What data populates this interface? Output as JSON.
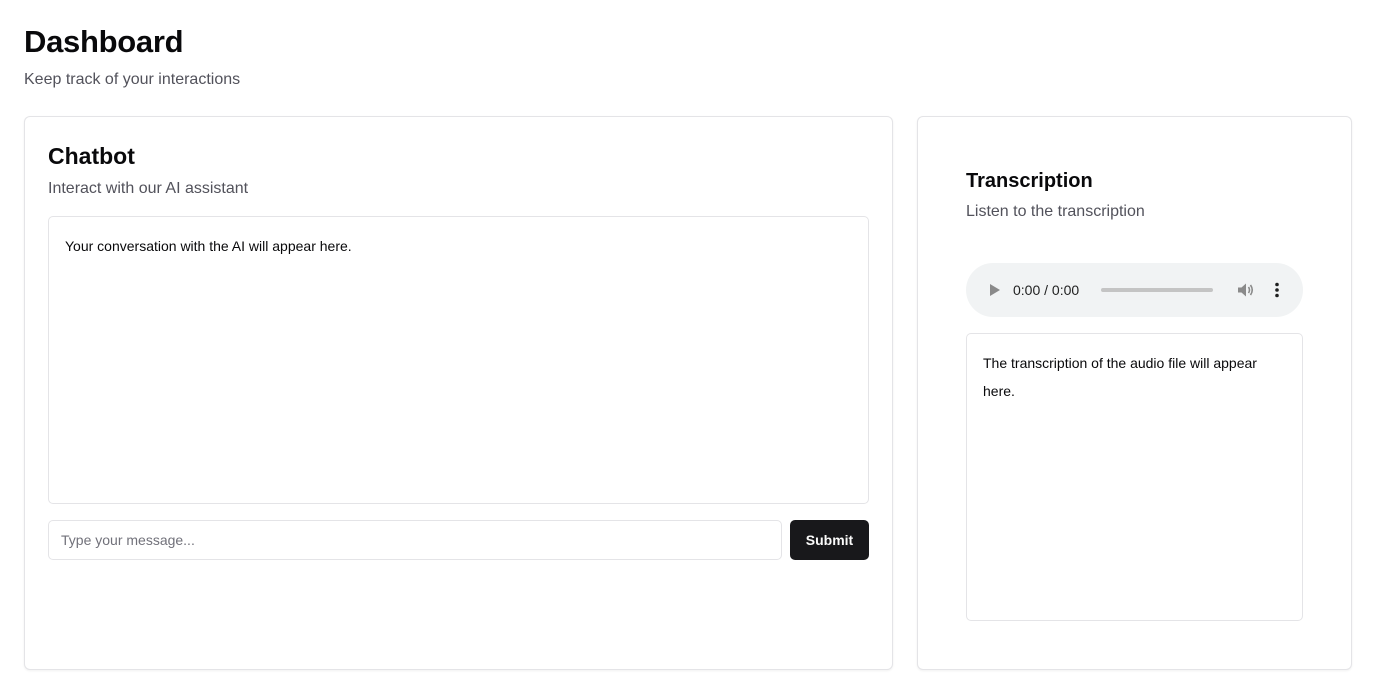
{
  "header": {
    "title": "Dashboard",
    "subtitle": "Keep track of your interactions"
  },
  "chatbot": {
    "title": "Chatbot",
    "subtitle": "Interact with our AI assistant",
    "conversation_placeholder": "Your conversation with the AI will appear here.",
    "input_placeholder": "Type your message...",
    "input_value": "",
    "submit_label": "Submit"
  },
  "transcription": {
    "title": "Transcription",
    "subtitle": "Listen to the transcription",
    "audio": {
      "time_display": "0:00 / 0:00",
      "progress": 0
    },
    "text_placeholder": "The transcription of the audio file will appear here."
  },
  "colors": {
    "primary_button": "#18181b",
    "border": "#e4e4e7",
    "muted_text": "#52525b",
    "audio_bg": "#f1f3f4"
  },
  "icons": [
    "play-icon",
    "volume-icon",
    "more-options-icon"
  ]
}
